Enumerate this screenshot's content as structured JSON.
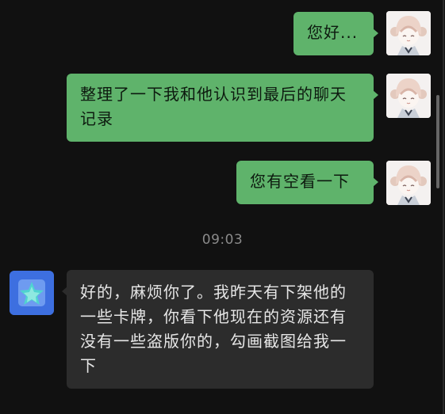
{
  "messages": [
    {
      "side": "out",
      "text": "您好..."
    },
    {
      "side": "out",
      "text": "整理了一下我和他认识到最后的聊天记录"
    },
    {
      "side": "out",
      "text": "您有空看一下"
    },
    {
      "side": "in",
      "text": "好的，麻烦你了。我昨天有下架他的一些卡牌，你看下他现在的资源还有没有一些盗版你的，勾画截图给我一下"
    }
  ],
  "timestamp": "09:03",
  "colors": {
    "background": "#111111",
    "outgoing_bubble": "#5fb36b",
    "incoming_bubble": "#2c2c2c",
    "timestamp_text": "#8a8a8a",
    "app_icon_blue": "#3d6fe0",
    "app_icon_teal": "#4fd3d0"
  },
  "icons": {
    "user_avatar": "anime-girl-avatar",
    "service_avatar": "star-app-icon"
  }
}
